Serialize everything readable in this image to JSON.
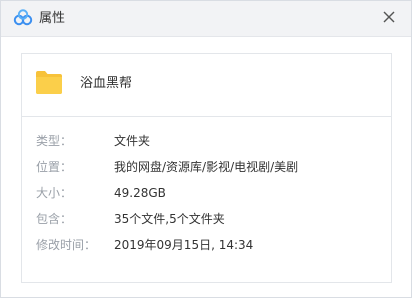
{
  "window": {
    "title": "属性",
    "icon": "baidu-netdisk-logo-icon",
    "close_icon": "close-icon"
  },
  "file": {
    "name": "浴血黑帮",
    "icon": "folder-icon",
    "icon_color": "#f7c23a"
  },
  "properties": [
    {
      "label": "类型：",
      "value": "文件夹"
    },
    {
      "label": "位置：",
      "value": "我的网盘/资源库/影视/电视剧/美剧"
    },
    {
      "label": "大小：",
      "value": "49.28GB"
    },
    {
      "label": "包含：",
      "value": "35个文件,5个文件夹"
    },
    {
      "label": "修改时间：",
      "value": "2019年09月15日, 14:34"
    }
  ],
  "colors": {
    "titlebar_bg": "#f2f3f5",
    "label_color": "#9aa0a8",
    "value_color": "#333333",
    "logo_blue": "#3b8ff0"
  }
}
